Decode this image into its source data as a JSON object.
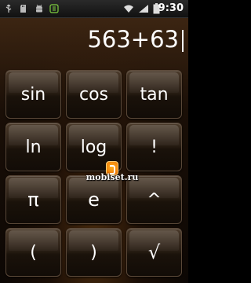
{
  "status_bar": {
    "time": "9:30",
    "icons": [
      "usb-icon",
      "sd-card-icon",
      "android-debug-icon",
      "sync-icon",
      "wifi-icon",
      "signal-icon",
      "battery-icon"
    ]
  },
  "display": {
    "expression": "563+63"
  },
  "keys": [
    {
      "label": "sin"
    },
    {
      "label": "cos"
    },
    {
      "label": "tan"
    },
    {
      "label": "ln"
    },
    {
      "label": "log"
    },
    {
      "label": "!"
    },
    {
      "label": "π"
    },
    {
      "label": "e"
    },
    {
      "label": "^"
    },
    {
      "label": "("
    },
    {
      "label": ")"
    },
    {
      "label": "√"
    }
  ],
  "watermark": {
    "text": "mobiset.ru"
  },
  "colors": {
    "text": "#ffffff",
    "background_top": "#3c2512",
    "background_bottom": "#0c0704",
    "key_border": "#5a4838"
  }
}
